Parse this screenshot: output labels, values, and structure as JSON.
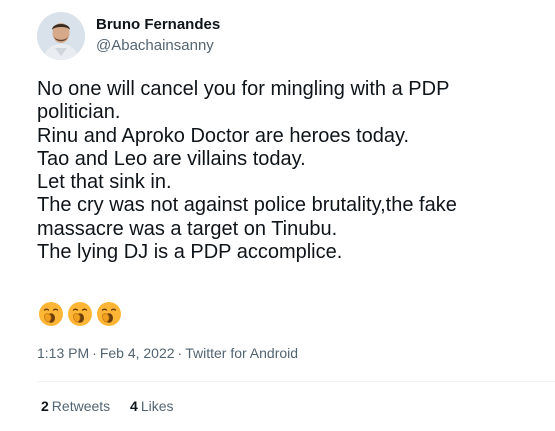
{
  "author": {
    "display_name": "Bruno Fernandes",
    "handle": "@Abachainsanny",
    "avatar_icon": "profile-avatar"
  },
  "tweet": {
    "lines": [
      "No one will cancel you for mingling with a PDP",
      "politician.",
      "Rinu and Aproko Doctor are heroes today.",
      "Tao and Leo are villains today.",
      "Let that sink in.",
      "The cry was not against police brutality,the fake",
      "massacre was a target on Tinubu.",
      "The lying DJ is a PDP accomplice."
    ],
    "emojis": [
      "yawning-face",
      "yawning-face",
      "yawning-face"
    ]
  },
  "meta": {
    "time": "1:13 PM",
    "separator": "·",
    "date": "Feb 4, 2022",
    "source": "Twitter for Android"
  },
  "stats": {
    "retweets_count": "2",
    "retweets_label": "Retweets",
    "likes_count": "4",
    "likes_label": "Likes"
  },
  "colors": {
    "text": "#0f1419",
    "secondary": "#536471",
    "divider": "#eff3f4",
    "emoji_face": "#ffb636"
  }
}
